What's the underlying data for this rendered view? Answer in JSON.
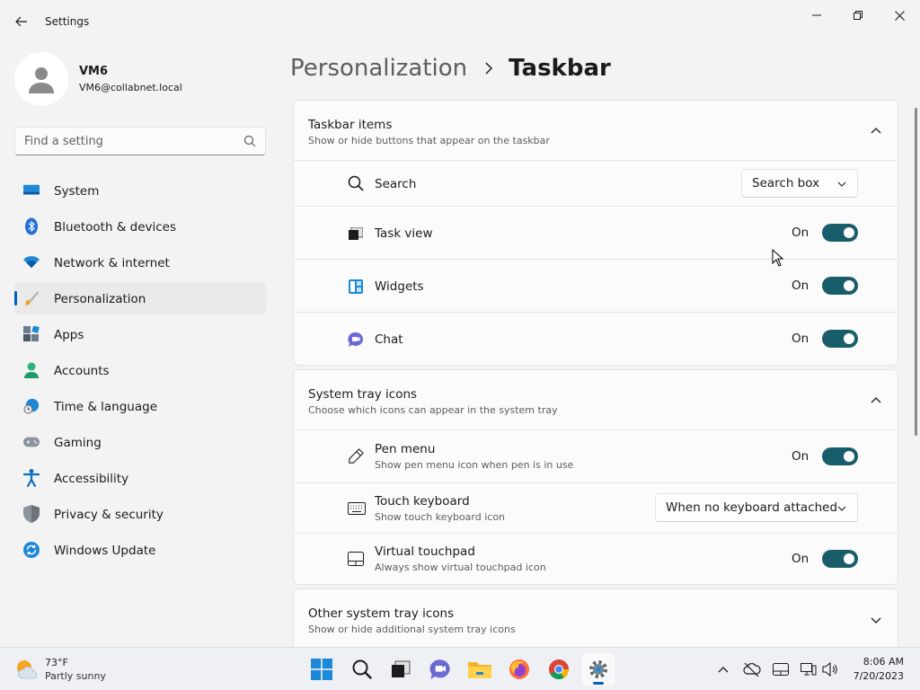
{
  "window": {
    "title": "Settings"
  },
  "profile": {
    "name": "VM6",
    "email": "VM6@collabnet.local"
  },
  "search": {
    "placeholder": "Find a setting"
  },
  "sidebar": {
    "items": [
      {
        "label": "System",
        "icon": "system-icon"
      },
      {
        "label": "Bluetooth & devices",
        "icon": "bluetooth-icon"
      },
      {
        "label": "Network & internet",
        "icon": "wifi-icon"
      },
      {
        "label": "Personalization",
        "icon": "brush-icon",
        "selected": true
      },
      {
        "label": "Apps",
        "icon": "apps-icon"
      },
      {
        "label": "Accounts",
        "icon": "accounts-icon"
      },
      {
        "label": "Time & language",
        "icon": "globe-clock-icon"
      },
      {
        "label": "Gaming",
        "icon": "gamepad-icon"
      },
      {
        "label": "Accessibility",
        "icon": "accessibility-icon"
      },
      {
        "label": "Privacy & security",
        "icon": "shield-icon"
      },
      {
        "label": "Windows Update",
        "icon": "update-icon"
      }
    ]
  },
  "breadcrumb": {
    "parent": "Personalization",
    "current": "Taskbar"
  },
  "sections": {
    "taskbar_items": {
      "title": "Taskbar items",
      "subtitle": "Show or hide buttons that appear on the taskbar",
      "rows": {
        "search": {
          "label": "Search",
          "value": "Search box"
        },
        "task_view": {
          "label": "Task view",
          "state": "On"
        },
        "widgets": {
          "label": "Widgets",
          "state": "On"
        },
        "chat": {
          "label": "Chat",
          "state": "On"
        }
      }
    },
    "system_tray": {
      "title": "System tray icons",
      "subtitle": "Choose which icons can appear in the system tray",
      "rows": {
        "pen": {
          "label": "Pen menu",
          "sub": "Show pen menu icon when pen is in use",
          "state": "On"
        },
        "touch_keyboard": {
          "label": "Touch keyboard",
          "sub": "Show touch keyboard icon",
          "value": "When no keyboard attached"
        },
        "touchpad": {
          "label": "Virtual touchpad",
          "sub": "Always show virtual touchpad icon",
          "state": "On"
        }
      }
    },
    "other_tray": {
      "title": "Other system tray icons",
      "subtitle": "Show or hide additional system tray icons"
    }
  },
  "taskbar": {
    "weather": {
      "temp": "73°F",
      "desc": "Partly sunny"
    },
    "clock": {
      "time": "8:06 AM",
      "date": "7/20/2023"
    }
  },
  "colors": {
    "accent": "#005fb8",
    "toggle_on": "#1a5d6a"
  }
}
